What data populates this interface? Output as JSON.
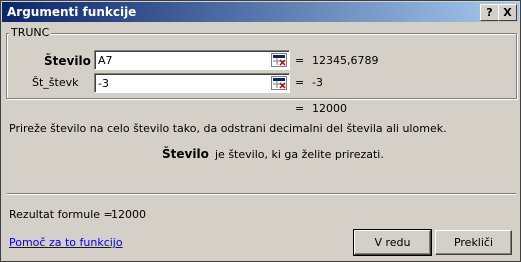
{
  "window": {
    "title": "Argumenti funkcije"
  },
  "titlebar_buttons": {
    "help": "?",
    "close": "X"
  },
  "function": {
    "name": "TRUNC"
  },
  "args": [
    {
      "label": "Število",
      "value": "A7",
      "result": "12345,6789"
    },
    {
      "label": "Št_števk",
      "value": "-3",
      "result": "-3"
    }
  ],
  "equals": "=",
  "overall_result": "12000",
  "description": "Prireže število na celo število tako, da odstrani decimalni del števila ali ulomek.",
  "arg_help": {
    "name": "Število",
    "text": "je število, ki ga želite prirezati."
  },
  "formula": {
    "label": "Rezultat formule =",
    "value": "12000"
  },
  "help_link": "Pomoč za to funkcijo",
  "buttons": {
    "ok": "V redu",
    "cancel": "Prekliči"
  },
  "icons": {
    "collapse": "range-select-icon"
  }
}
